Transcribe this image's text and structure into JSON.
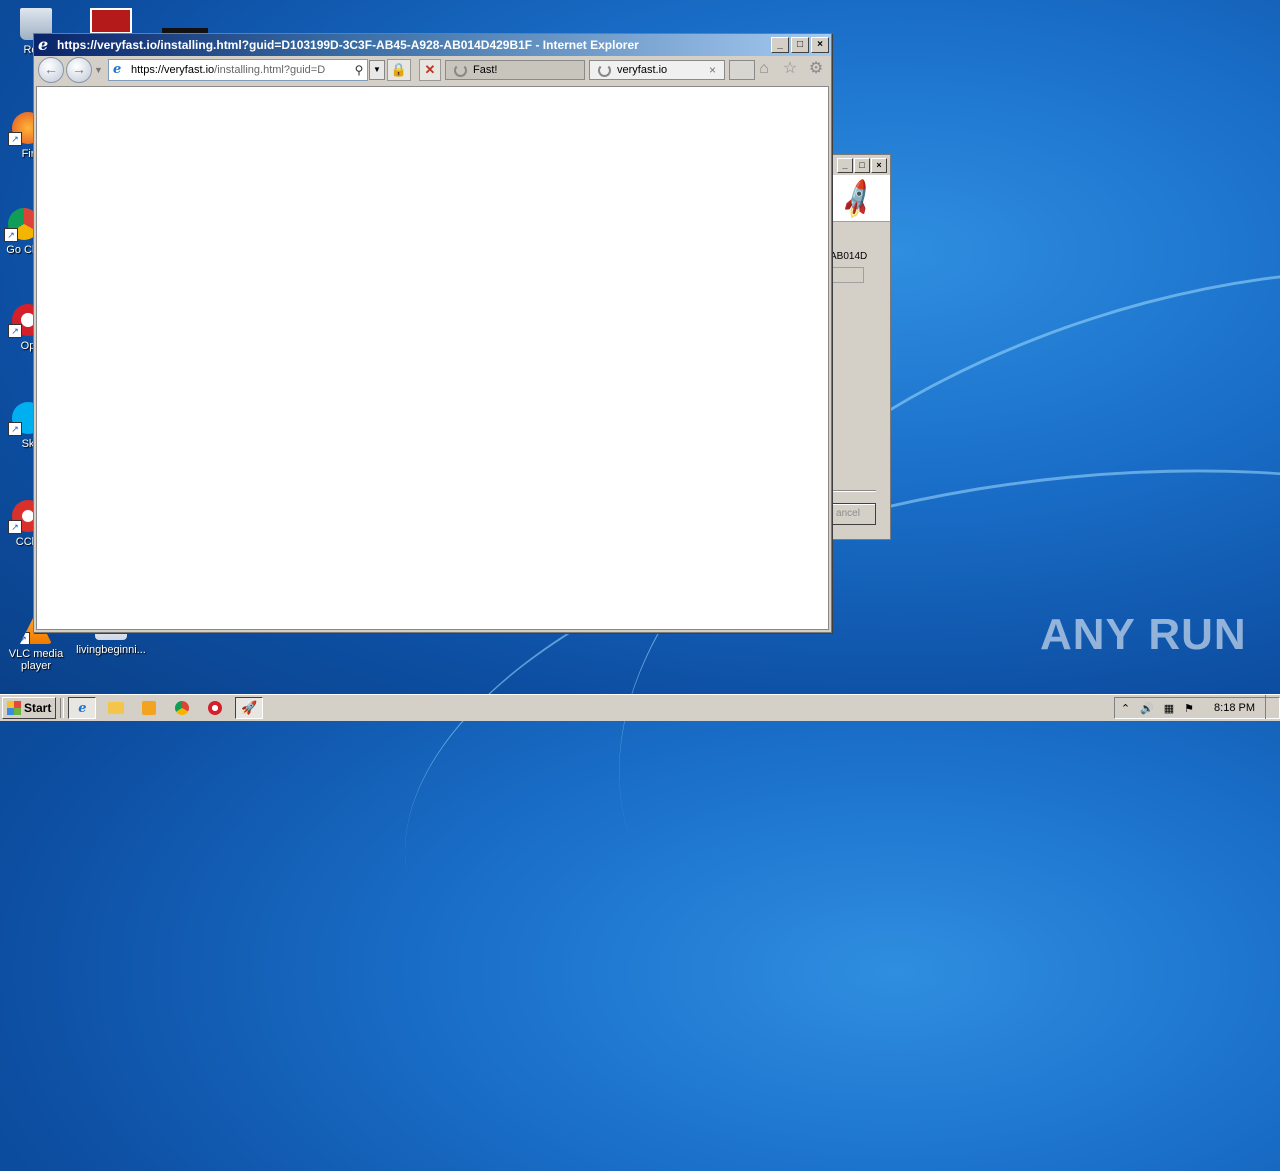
{
  "desktop": {
    "icons": [
      {
        "label": "Recy",
        "icon": "recycle-bin-icon"
      },
      {
        "label": "Fir",
        "icon": "firefox-icon"
      },
      {
        "label": "Go Chr",
        "icon": "chrome-icon"
      },
      {
        "label": "Op",
        "icon": "opera-icon"
      },
      {
        "label": "Sk",
        "icon": "skype-icon"
      },
      {
        "label": "CCle",
        "icon": "ccleaner-icon"
      },
      {
        "label": "VLC media player",
        "icon": "vlc-icon"
      },
      {
        "label": "livingbeginni...",
        "icon": "document-icon"
      }
    ]
  },
  "ie_window": {
    "title": "https://veryfast.io/installing.html?guid=D103199D-3C3F-AB45-A928-AB014D429B1F - Internet Explorer",
    "address_prefix": "https://veryfast.io",
    "address_suffix": "/installing.html?guid=D",
    "tabs": [
      {
        "label": "Fast!",
        "state": "inactive"
      },
      {
        "label": "veryfast.io",
        "state": "active"
      }
    ],
    "tab_close": "×"
  },
  "installer_window": {
    "partial_text": "AB014D",
    "cancel_label": "ancel"
  },
  "taskbar": {
    "start_label": "Start",
    "clock": "8:18 PM"
  },
  "watermark": "ANY RUN",
  "colors": {
    "titlebar": "#0a246a",
    "desktop": "#1a6fc9",
    "chrome": "#d4d0c8"
  }
}
